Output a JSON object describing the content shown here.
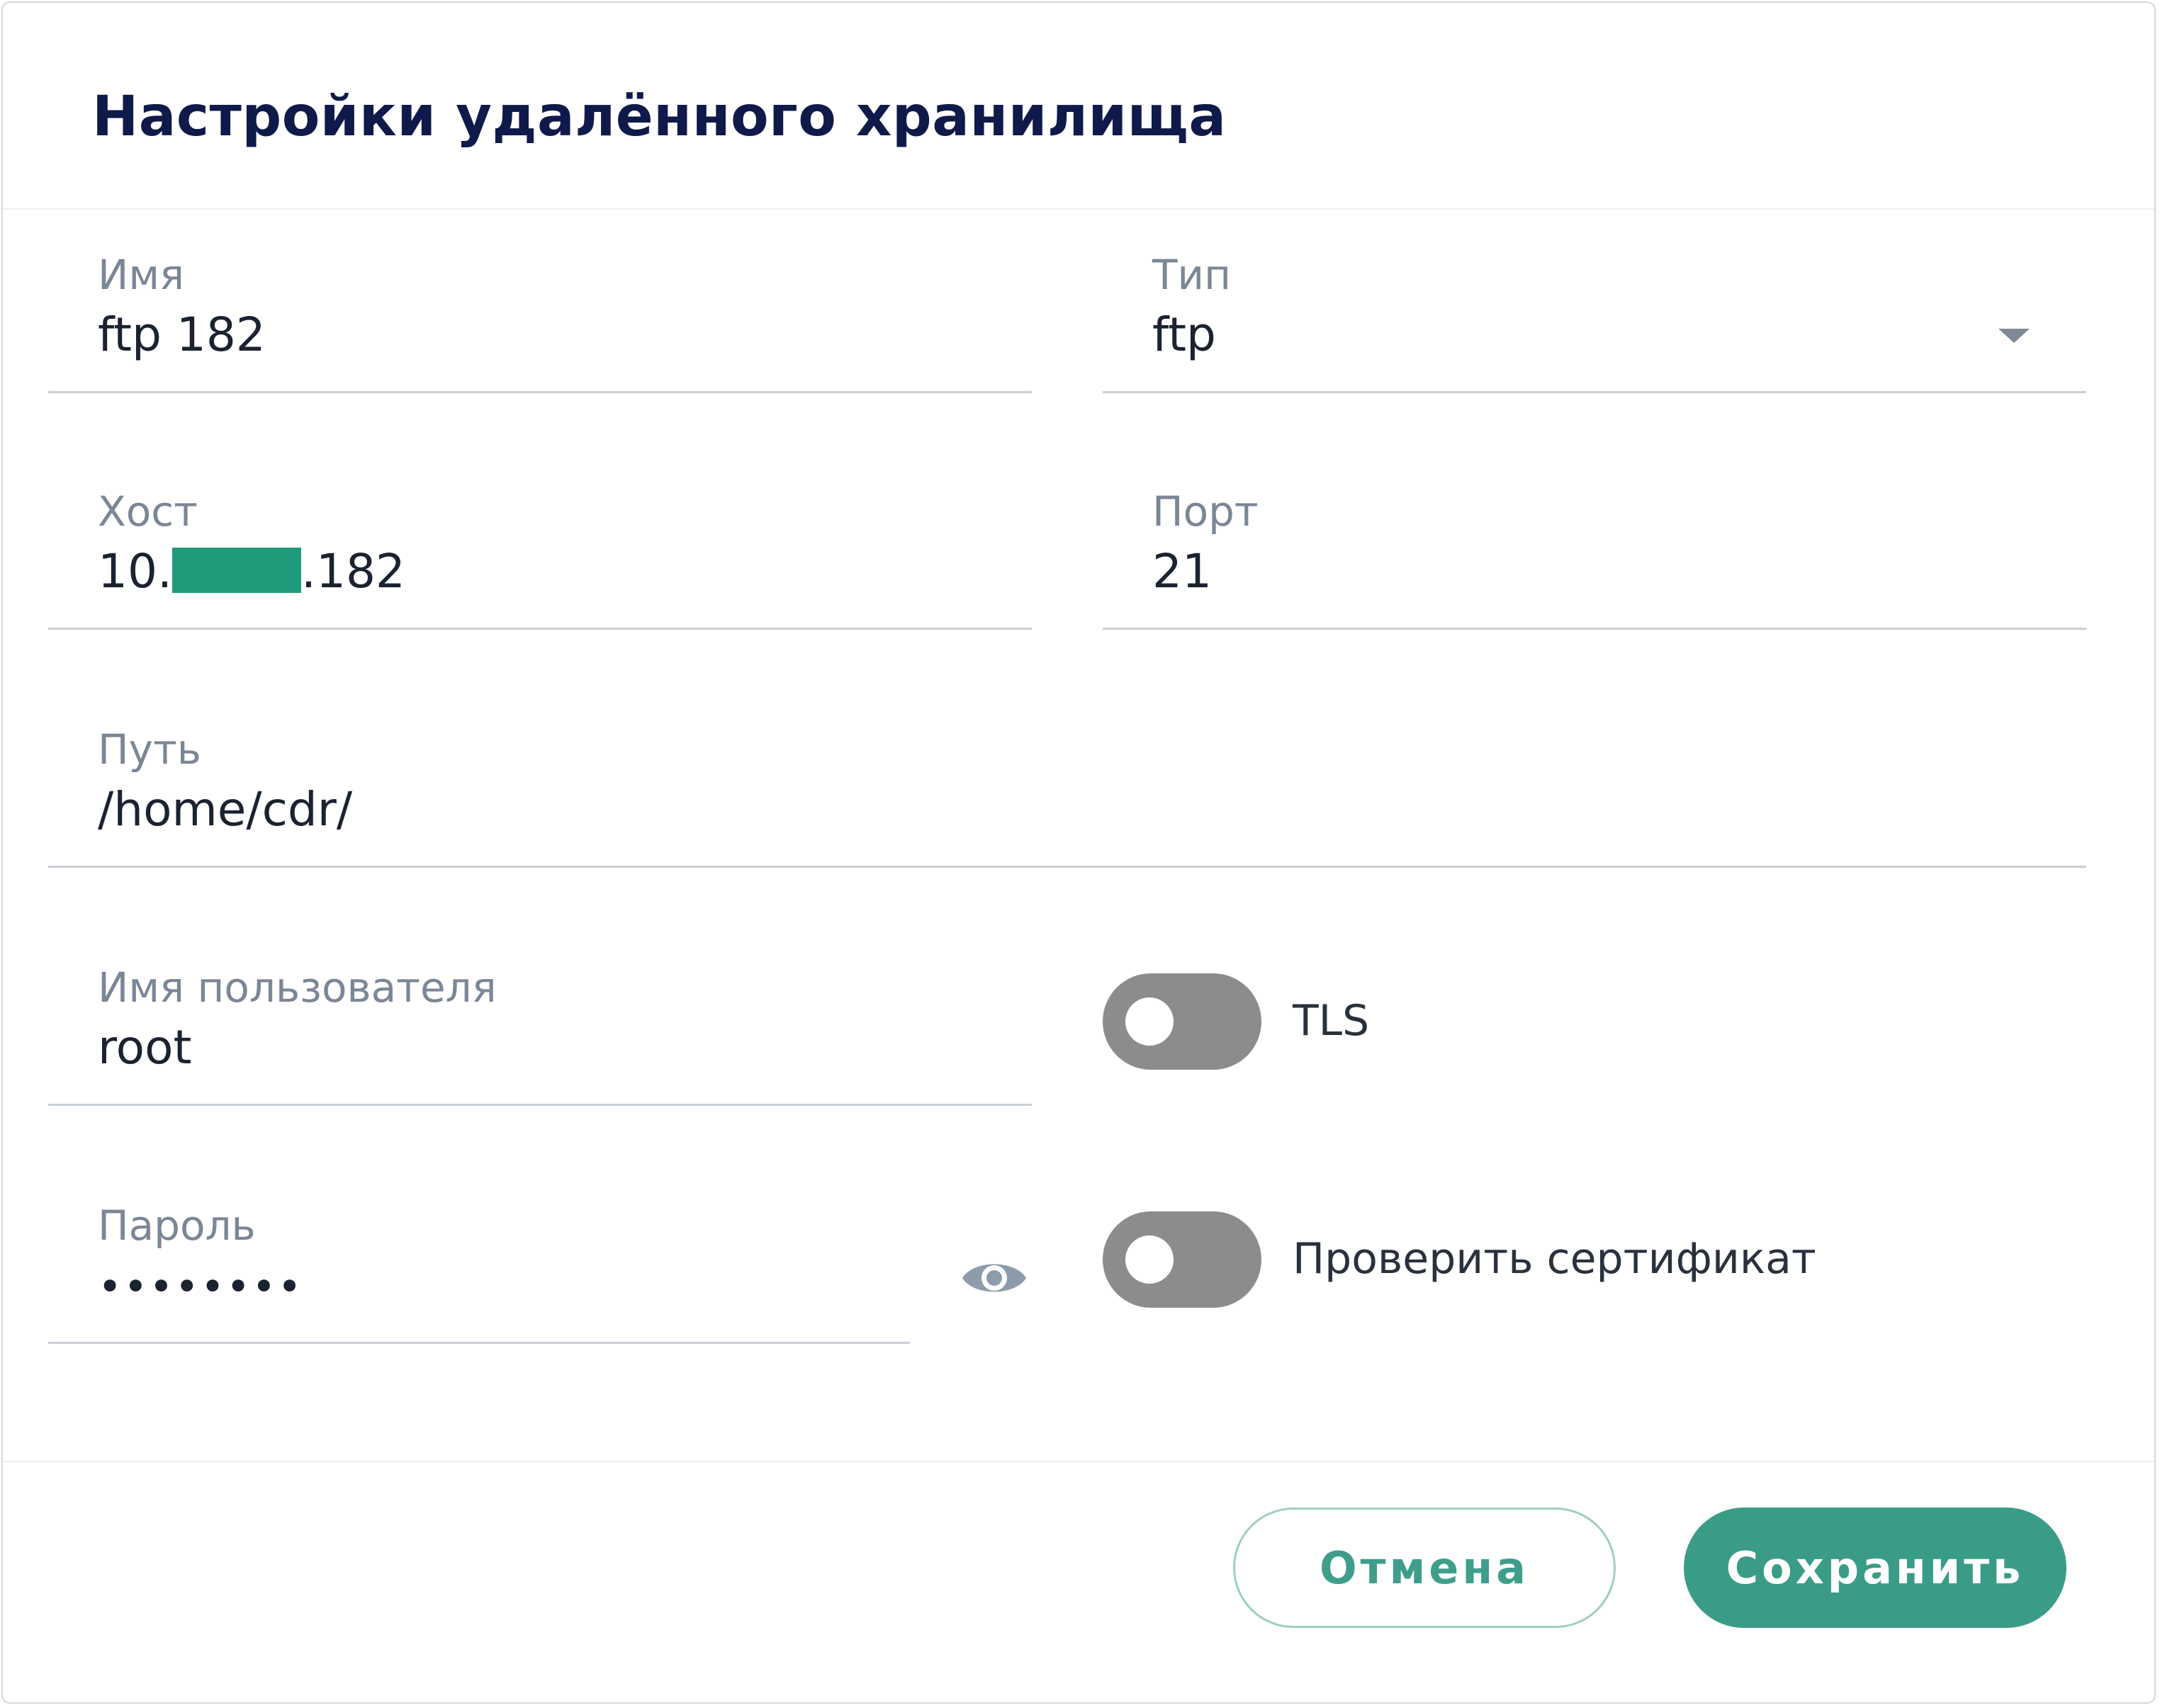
{
  "dialog": {
    "title": "Настройки удалённого хранилища"
  },
  "fields": {
    "name": {
      "label": "Имя",
      "value": "ftp 182"
    },
    "type": {
      "label": "Тип",
      "value": "ftp"
    },
    "host": {
      "label": "Хост",
      "value_prefix": "10.",
      "value_suffix": ".182",
      "masked_color": "#1f9a7a"
    },
    "port": {
      "label": "Порт",
      "value": "21"
    },
    "path": {
      "label": "Путь",
      "value": "/home/cdr/"
    },
    "username": {
      "label": "Имя пользователя",
      "value": "root"
    },
    "password": {
      "label": "Пароль",
      "value": "••••••••",
      "toggle_icon": "eye-icon"
    }
  },
  "toggles": {
    "tls": {
      "label": "TLS",
      "checked": false
    },
    "verify_cert": {
      "label": "Проверить сертификат",
      "checked": false
    }
  },
  "buttons": {
    "cancel": "Отмена",
    "save": "Сохранить"
  },
  "colors": {
    "accent": "#3a9c87",
    "title": "#0f1a4a",
    "toggle_off": "#8c8c8c"
  }
}
